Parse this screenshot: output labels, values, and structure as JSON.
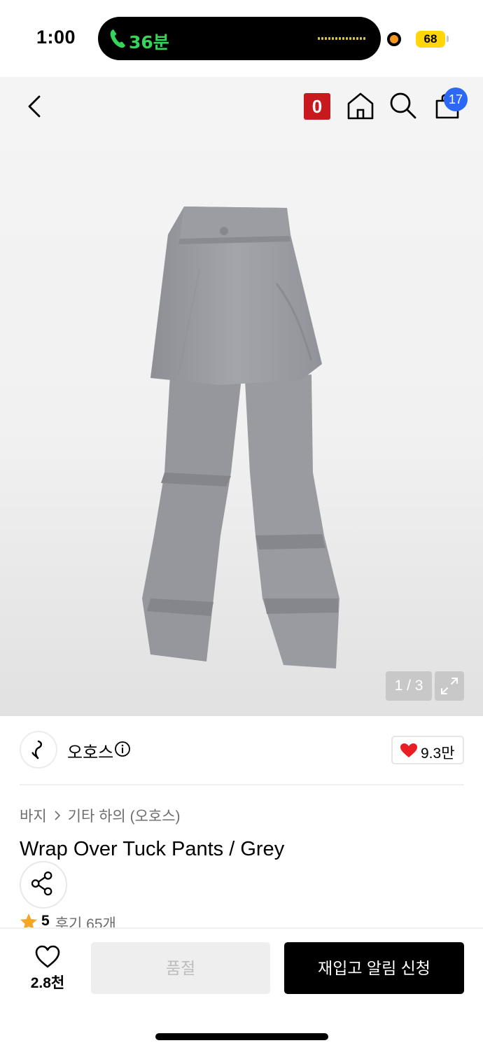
{
  "status_bar": {
    "time": "1:00",
    "call_duration": "36분",
    "battery": "68",
    "colors": {
      "call_green": "#35d45a",
      "battery_yellow": "#ffd60a",
      "record_orange": "#f7961d"
    }
  },
  "nav": {
    "point_badge": "0",
    "cart_count": "17",
    "icons": [
      "back-arrow-icon",
      "home-icon",
      "search-icon",
      "cart-icon"
    ],
    "colors": {
      "point_red": "#c8191e",
      "badge_blue": "#2b68f5"
    }
  },
  "gallery": {
    "counter": "1 / 3",
    "expand_icon": "expand-arrows-icon"
  },
  "brand": {
    "name": "오호스",
    "likes": "9.3만"
  },
  "breadcrumb": {
    "category": "바지",
    "subcategory": "기타 하의 (오호스)"
  },
  "product": {
    "title": "Wrap Over Tuck Pants / Grey",
    "rating": "5",
    "reviews": "후기 65개"
  },
  "bottom_bar": {
    "wish_count": "2.8천",
    "soldout_label": "품절",
    "restock_label": "재입고 알림 신청"
  }
}
